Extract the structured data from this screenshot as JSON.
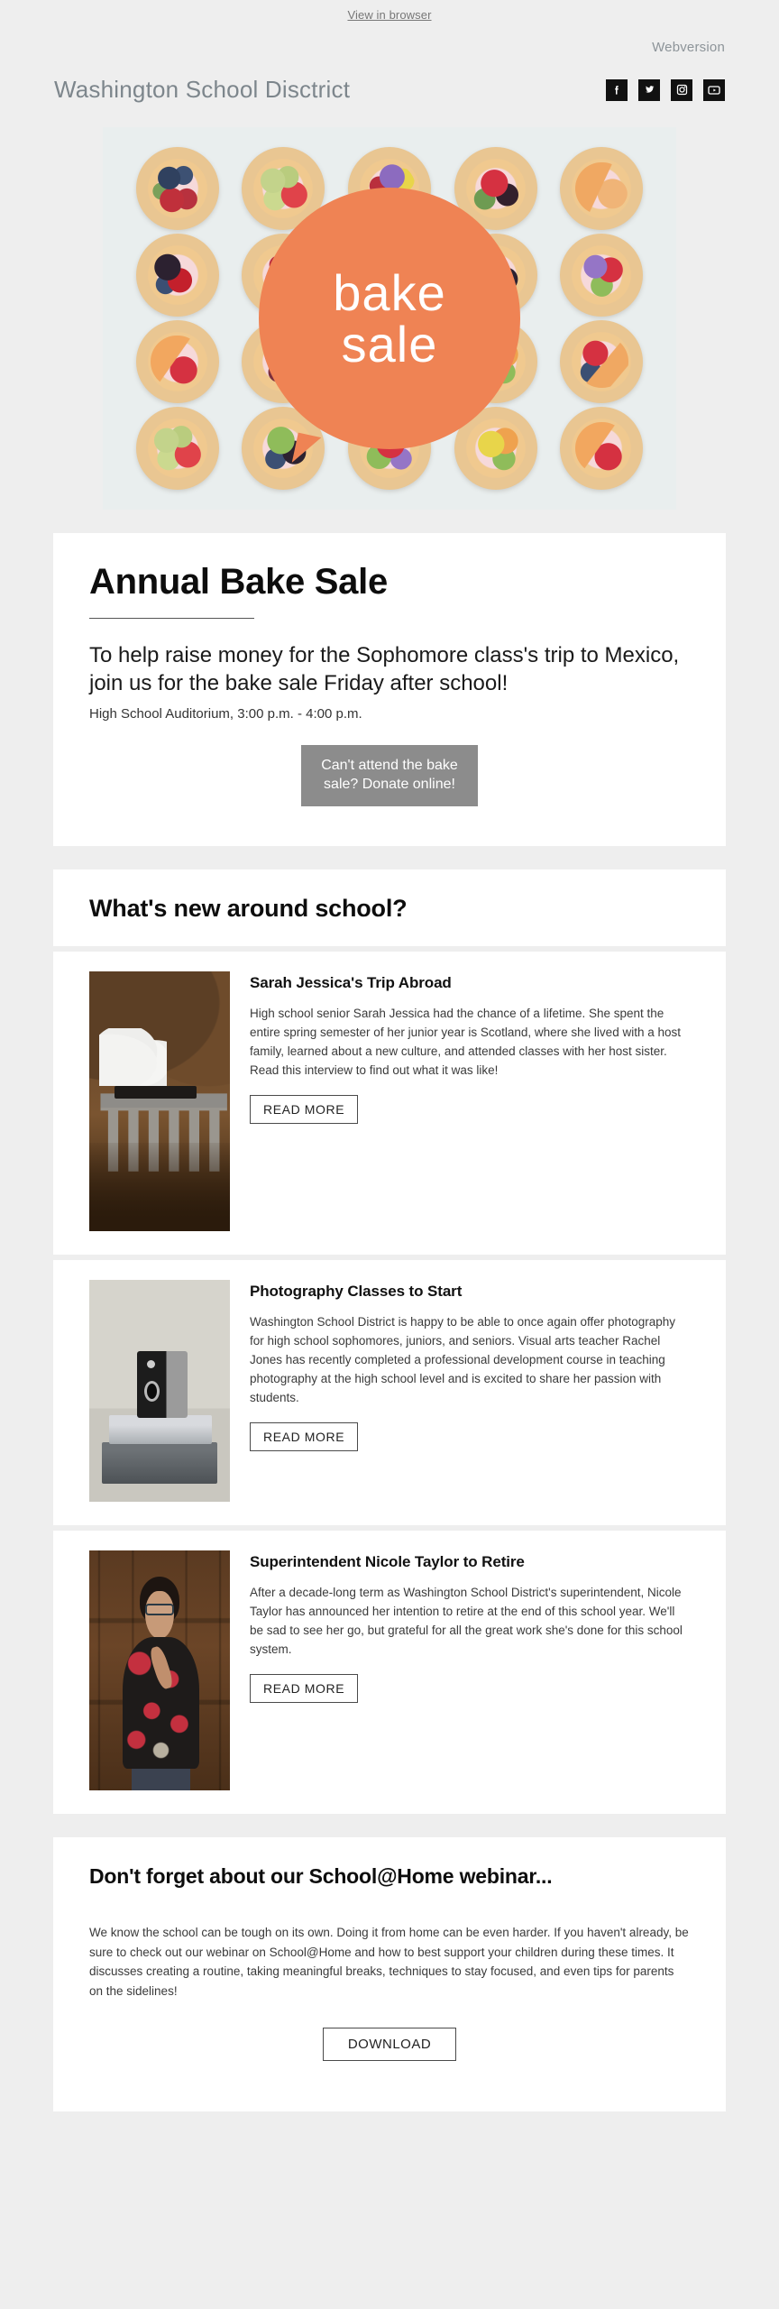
{
  "preheader": {
    "view_in_browser": "View in browser"
  },
  "header": {
    "webversion": "Webversion",
    "brand": "Washington School Disctrict",
    "social": [
      {
        "name": "facebook-icon",
        "label": "Facebook"
      },
      {
        "name": "twitter-icon",
        "label": "Twitter"
      },
      {
        "name": "instagram-icon",
        "label": "Instagram"
      },
      {
        "name": "youtube-icon",
        "label": "YouTube"
      }
    ]
  },
  "hero": {
    "badge_line1": "bake",
    "badge_line2": "sale",
    "badge_color": "#ef8354",
    "alt": "Fruit-topped mini tarts arranged in a grid"
  },
  "intro": {
    "title": "Annual Bake Sale",
    "lede": "To help raise money for the Sophomore class's trip to Mexico, join us for the bake sale Friday after school!",
    "meta": "High School Auditorium, 3:00 p.m. - 4:00 p.m.",
    "cta": "Can't attend the bake sale? Donate online!",
    "cta_bg": "#8c8c8c"
  },
  "news": {
    "heading": "What's new around school?",
    "read_more_label": "READ MORE",
    "articles": [
      {
        "title": "Sarah Jessica's Trip Abroad",
        "body": "High school senior Sarah Jessica had the chance of a lifetime. She spent the entire spring semester of her junior year is Scotland, where she lived with a host family, learned about a new culture, and attended classes with her host sister. Read this interview to find out what it was like!",
        "image_alt": "Steam train crossing a stone viaduct in autumn highlands"
      },
      {
        "title": "Photography Classes to Start",
        "body": "Washington School District is happy to be able to once again offer photography for high school sophomores, juniors, and seniors. Visual arts teacher Rachel Jones has recently completed a professional development course in teaching photography at the high school level and is excited to share her passion with students.",
        "image_alt": "Vintage box camera resting on a stack of two books"
      },
      {
        "title": "Superintendent Nicole Taylor to Retire",
        "body": "After a decade-long term as Washington School District's superintendent, Nicole Taylor has announced her intention to retire at the end of this school year. We'll be sad to see her go, but grateful for all the great work she's done for this school system.",
        "image_alt": "Woman with glasses in a floral top in front of a wooden door"
      }
    ]
  },
  "webinar": {
    "heading": "Don't forget about our School@Home webinar...",
    "body": "We know the school can be tough on its own. Doing it from home can be even harder. If you haven't already, be sure to check out our webinar on School@Home and how to best support your children during these times. It discusses creating a routine, taking meaningful breaks, techniques to stay focused, and even tips for parents on the sidelines!",
    "cta": "DOWNLOAD"
  }
}
